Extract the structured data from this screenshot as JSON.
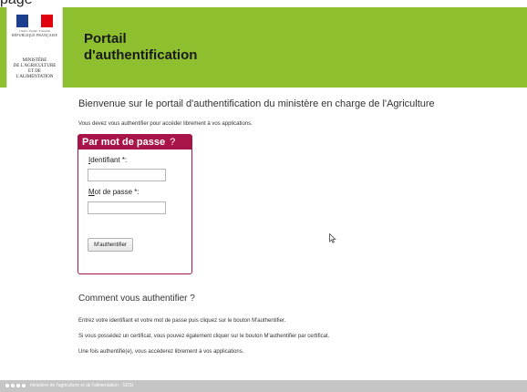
{
  "top_strip_text": "page",
  "header": {
    "title_line1": "Portail",
    "title_line2": "d'authentification",
    "accent_color": "#8dbf2e",
    "logo": {
      "motto": "Liberté • Égalité • Fraternité",
      "republic": "RÉPUBLIQUE FRANÇAISE",
      "ministry_line1": "MINISTÈRE",
      "ministry_line2": "DE L'AGRICULTURE",
      "ministry_line3": "ET DE",
      "ministry_line4": "L'ALIMENTATION"
    }
  },
  "main": {
    "welcome": "Bienvenue sur le portail d'authentification du ministère en charge de l'Agriculture",
    "intro": "Vous devez vous authentifier pour accéder librement à vos applications."
  },
  "login": {
    "header": "Par mot de passe",
    "help": "?",
    "brand_color": "#a8144a",
    "username_label_first": "I",
    "username_label_rest": "dentifiant *:",
    "username_value": "",
    "password_label_first": "M",
    "password_label_rest": "ot de passe *:",
    "password_value": "",
    "submit_label": "M'authentifier"
  },
  "how": {
    "title": "Comment vous authentifier ?",
    "lines": [
      "Entrez votre identifiant et votre mot de passe puis cliquez sur le bouton M'authentifier.",
      "Si vous possédez un certificat, vous pouvez également cliquer sur le bouton M'authentifier par certificat.",
      "Une fois authentifié(e), vous accéderez librement à vos applications."
    ]
  },
  "footer": {
    "text": "ministère de l'agriculture et de l'alimentation - SDSI"
  },
  "icons": {
    "cursor": "mouse-pointer-icon"
  }
}
